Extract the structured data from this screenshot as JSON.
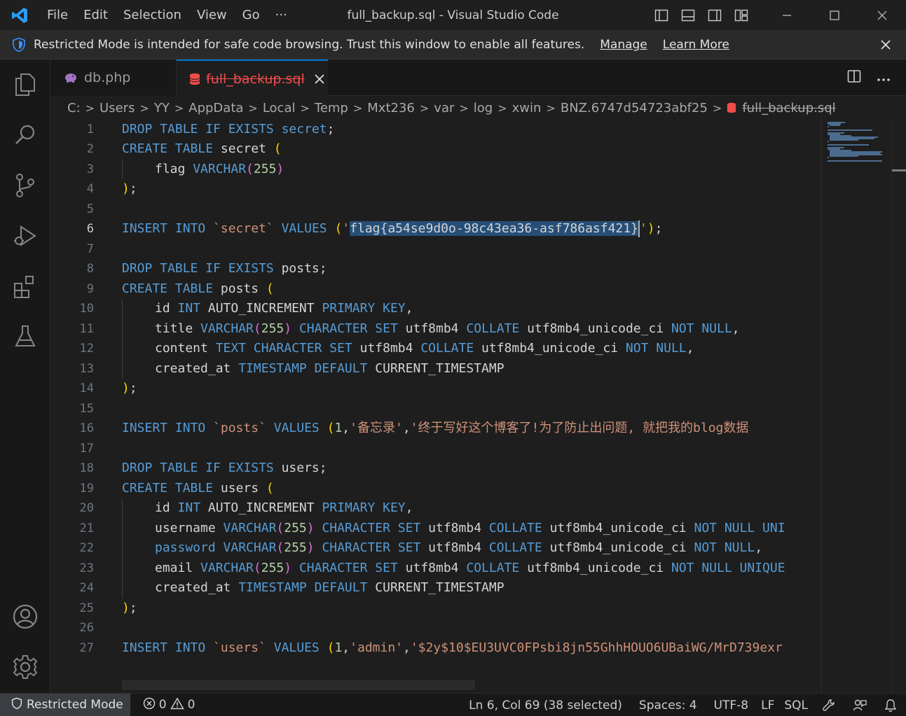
{
  "window": {
    "title": "full_backup.sql - Visual Studio Code",
    "menu": [
      "File",
      "Edit",
      "Selection",
      "View",
      "Go",
      "···"
    ]
  },
  "banner": {
    "message": "Restricted Mode is intended for safe code browsing. Trust this window to enable all features.",
    "manage": "Manage",
    "learn_more": "Learn More"
  },
  "tabs": [
    {
      "label": "db.php",
      "icon": "php-elephant-icon",
      "active": false
    },
    {
      "label": "full_backup.sql",
      "icon": "database-icon",
      "active": true
    }
  ],
  "breadcrumb": [
    "C:",
    "Users",
    "YY",
    "AppData",
    "Local",
    "Temp",
    "Mxt236",
    "var",
    "log",
    "xwin",
    "BNZ.6747d54723abf25",
    "full_backup.sql"
  ],
  "editor": {
    "active_line": 6,
    "selection": "flag{a54se9d0o-98c43ea36-asf786asf421}",
    "lines": [
      {
        "n": "1",
        "indent": 0,
        "tokens": [
          [
            "kw",
            "DROP TABLE IF EXISTS "
          ],
          [
            "kw",
            "secret"
          ],
          [
            "plain",
            ";"
          ]
        ]
      },
      {
        "n": "2",
        "indent": 0,
        "tokens": [
          [
            "kw",
            "CREATE TABLE "
          ],
          [
            "plain",
            "secret "
          ],
          [
            "bracket",
            "("
          ]
        ]
      },
      {
        "n": "3",
        "indent": 1,
        "tokens": [
          [
            "plain",
            "flag "
          ],
          [
            "kw",
            "VARCHAR"
          ],
          [
            "bracket2",
            "("
          ],
          [
            "num",
            "255"
          ],
          [
            "bracket2",
            ")"
          ]
        ]
      },
      {
        "n": "4",
        "indent": 0,
        "tokens": [
          [
            "bracket",
            ")"
          ],
          [
            "plain",
            ";"
          ]
        ]
      },
      {
        "n": "5",
        "indent": 0,
        "tokens": []
      },
      {
        "n": "6",
        "indent": 0,
        "tokens": [
          [
            "kw",
            "INSERT INTO "
          ],
          [
            "str",
            "`secret`"
          ],
          [
            "plain",
            " "
          ],
          [
            "kw",
            "VALUES "
          ],
          [
            "bracket",
            "("
          ],
          [
            "str",
            "'"
          ],
          [
            "sel",
            "flag{a54se9d0o-98c43ea36-asf786asf421}"
          ],
          [
            "cursor",
            ""
          ],
          [
            "str",
            "'"
          ],
          [
            "bracket",
            ")"
          ],
          [
            "plain",
            ";"
          ]
        ]
      },
      {
        "n": "7",
        "indent": 0,
        "tokens": []
      },
      {
        "n": "8",
        "indent": 0,
        "tokens": [
          [
            "kw",
            "DROP TABLE IF EXISTS "
          ],
          [
            "plain",
            "posts;"
          ]
        ]
      },
      {
        "n": "9",
        "indent": 0,
        "tokens": [
          [
            "kw",
            "CREATE TABLE "
          ],
          [
            "plain",
            "posts "
          ],
          [
            "bracket",
            "("
          ]
        ]
      },
      {
        "n": "10",
        "indent": 1,
        "tokens": [
          [
            "plain",
            "id "
          ],
          [
            "kw",
            "INT "
          ],
          [
            "plain",
            "AUTO_INCREMENT "
          ],
          [
            "kw",
            "PRIMARY KEY"
          ],
          [
            "plain",
            ","
          ]
        ]
      },
      {
        "n": "11",
        "indent": 1,
        "tokens": [
          [
            "plain",
            "title "
          ],
          [
            "kw",
            "VARCHAR"
          ],
          [
            "bracket2",
            "("
          ],
          [
            "num",
            "255"
          ],
          [
            "bracket2",
            ")"
          ],
          [
            "plain",
            " "
          ],
          [
            "kw",
            "CHARACTER SET "
          ],
          [
            "plain",
            "utf8mb4 "
          ],
          [
            "kw",
            "COLLATE "
          ],
          [
            "plain",
            "utf8mb4_unicode_ci "
          ],
          [
            "kw",
            "NOT NULL"
          ],
          [
            "plain",
            ","
          ]
        ]
      },
      {
        "n": "12",
        "indent": 1,
        "tokens": [
          [
            "plain",
            "content "
          ],
          [
            "kw",
            "TEXT CHARACTER SET "
          ],
          [
            "plain",
            "utf8mb4 "
          ],
          [
            "kw",
            "COLLATE "
          ],
          [
            "plain",
            "utf8mb4_unicode_ci "
          ],
          [
            "kw",
            "NOT NULL"
          ],
          [
            "plain",
            ","
          ]
        ]
      },
      {
        "n": "13",
        "indent": 1,
        "tokens": [
          [
            "plain",
            "created_at "
          ],
          [
            "kw",
            "TIMESTAMP DEFAULT "
          ],
          [
            "plain",
            "CURRENT_TIMESTAMP"
          ]
        ]
      },
      {
        "n": "14",
        "indent": 0,
        "tokens": [
          [
            "bracket",
            ")"
          ],
          [
            "plain",
            ";"
          ]
        ]
      },
      {
        "n": "15",
        "indent": 0,
        "tokens": []
      },
      {
        "n": "16",
        "indent": 0,
        "tokens": [
          [
            "kw",
            "INSERT INTO "
          ],
          [
            "str",
            "`posts`"
          ],
          [
            "plain",
            " "
          ],
          [
            "kw",
            "VALUES "
          ],
          [
            "bracket",
            "("
          ],
          [
            "num",
            "1"
          ],
          [
            "plain",
            ","
          ],
          [
            "str",
            "'备忘录'"
          ],
          [
            "plain",
            ","
          ],
          [
            "str",
            "'终于写好这个博客了!为了防止出问题, 就把我的blog数据"
          ]
        ]
      },
      {
        "n": "17",
        "indent": 0,
        "tokens": []
      },
      {
        "n": "18",
        "indent": 0,
        "tokens": [
          [
            "kw",
            "DROP TABLE IF EXISTS "
          ],
          [
            "plain",
            "users;"
          ]
        ]
      },
      {
        "n": "19",
        "indent": 0,
        "tokens": [
          [
            "kw",
            "CREATE TABLE "
          ],
          [
            "plain",
            "users "
          ],
          [
            "bracket",
            "("
          ]
        ]
      },
      {
        "n": "20",
        "indent": 1,
        "tokens": [
          [
            "plain",
            "id "
          ],
          [
            "kw",
            "INT "
          ],
          [
            "plain",
            "AUTO_INCREMENT "
          ],
          [
            "kw",
            "PRIMARY KEY"
          ],
          [
            "plain",
            ","
          ]
        ]
      },
      {
        "n": "21",
        "indent": 1,
        "tokens": [
          [
            "plain",
            "username "
          ],
          [
            "kw",
            "VARCHAR"
          ],
          [
            "bracket2",
            "("
          ],
          [
            "num",
            "255"
          ],
          [
            "bracket2",
            ")"
          ],
          [
            "plain",
            " "
          ],
          [
            "kw",
            "CHARACTER SET "
          ],
          [
            "plain",
            "utf8mb4 "
          ],
          [
            "kw",
            "COLLATE "
          ],
          [
            "plain",
            "utf8mb4_unicode_ci "
          ],
          [
            "kw",
            "NOT NULL UNI"
          ]
        ]
      },
      {
        "n": "22",
        "indent": 1,
        "tokens": [
          [
            "kw",
            "password "
          ],
          [
            "kw",
            "VARCHAR"
          ],
          [
            "bracket2",
            "("
          ],
          [
            "num",
            "255"
          ],
          [
            "bracket2",
            ")"
          ],
          [
            "plain",
            " "
          ],
          [
            "kw",
            "CHARACTER SET "
          ],
          [
            "plain",
            "utf8mb4 "
          ],
          [
            "kw",
            "COLLATE "
          ],
          [
            "plain",
            "utf8mb4_unicode_ci "
          ],
          [
            "kw",
            "NOT NULL"
          ],
          [
            "plain",
            ","
          ]
        ]
      },
      {
        "n": "23",
        "indent": 1,
        "tokens": [
          [
            "plain",
            "email "
          ],
          [
            "kw",
            "VARCHAR"
          ],
          [
            "bracket2",
            "("
          ],
          [
            "num",
            "255"
          ],
          [
            "bracket2",
            ")"
          ],
          [
            "plain",
            " "
          ],
          [
            "kw",
            "CHARACTER SET "
          ],
          [
            "plain",
            "utf8mb4 "
          ],
          [
            "kw",
            "COLLATE "
          ],
          [
            "plain",
            "utf8mb4_unicode_ci "
          ],
          [
            "kw",
            "NOT NULL UNIQUE"
          ]
        ]
      },
      {
        "n": "24",
        "indent": 1,
        "tokens": [
          [
            "plain",
            "created_at "
          ],
          [
            "kw",
            "TIMESTAMP DEFAULT "
          ],
          [
            "plain",
            "CURRENT_TIMESTAMP"
          ]
        ]
      },
      {
        "n": "25",
        "indent": 0,
        "tokens": [
          [
            "bracket",
            ")"
          ],
          [
            "plain",
            ";"
          ]
        ]
      },
      {
        "n": "26",
        "indent": 0,
        "tokens": []
      },
      {
        "n": "27",
        "indent": 0,
        "tokens": [
          [
            "kw",
            "INSERT INTO "
          ],
          [
            "str",
            "`users`"
          ],
          [
            "plain",
            " "
          ],
          [
            "kw",
            "VALUES "
          ],
          [
            "bracket",
            "("
          ],
          [
            "num",
            "1"
          ],
          [
            "plain",
            ","
          ],
          [
            "str",
            "'admin'"
          ],
          [
            "plain",
            ","
          ],
          [
            "str",
            "'$2y$10$EU3UVC0FPsbi8jn55GhhHOUO6UBaiWG/MrD739exr"
          ]
        ]
      }
    ]
  },
  "status": {
    "restricted": "Restricted Mode",
    "errors": "0",
    "warnings": "0",
    "position": "Ln 6, Col 69 (38 selected)",
    "spaces": "Spaces: 4",
    "encoding": "UTF-8",
    "eol": "LF",
    "language": "SQL"
  },
  "colors": {
    "accent": "#0078d4",
    "keyword": "#569cd6",
    "string": "#ce9178",
    "number": "#b5cea8",
    "bracket": "#ffd700",
    "selection": "#264f78",
    "tab_modified": "#f14c4c"
  }
}
